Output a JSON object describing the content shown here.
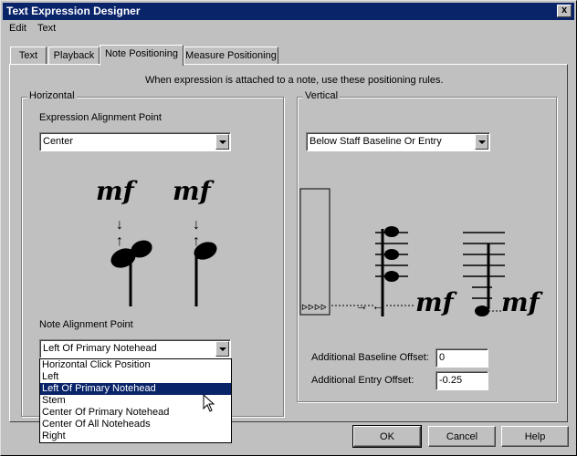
{
  "window": {
    "title": "Text Expression Designer",
    "close_glyph": "x"
  },
  "menu": {
    "items": [
      "Edit",
      "Text"
    ]
  },
  "tabs": [
    "Text",
    "Playback",
    "Note Positioning",
    "Measure Positioning"
  ],
  "active_tab": "Note Positioning",
  "instruction": "When expression is attached to a note, use these positioning rules.",
  "horizontal": {
    "group_label": "Horizontal",
    "expression_alignment_label": "Expression Alignment Point",
    "expression_alignment_value": "Center",
    "note_alignment_label": "Note Alignment Point",
    "note_alignment_value": "Left Of Primary Notehead",
    "note_alignment_options": [
      "Horizontal Click Position",
      "Left",
      "Left Of Primary Notehead",
      "Stem",
      "Center Of Primary Notehead",
      "Center Of All Noteheads",
      "Right"
    ],
    "selected_option_index": 2
  },
  "vertical": {
    "group_label": "Vertical",
    "position_value": "Below Staff Baseline Or Entry",
    "baseline_offset_label": "Additional Baseline Offset:",
    "baseline_offset_value": "0",
    "entry_offset_label": "Additional Entry Offset:",
    "entry_offset_value": "-0.25"
  },
  "illustration": {
    "dynamic_text": "mf",
    "arrow_down": "↓",
    "arrow_up": "↑",
    "arrow_right": "→",
    "arrow_left": "←",
    "triangles": "ᐅᐅᐅᐅ"
  },
  "buttons": {
    "ok": "OK",
    "cancel": "Cancel",
    "help": "Help"
  },
  "colors": {
    "title_bar": "#0a246a",
    "face": "#c0c0c0",
    "selection": "#0a246a"
  }
}
